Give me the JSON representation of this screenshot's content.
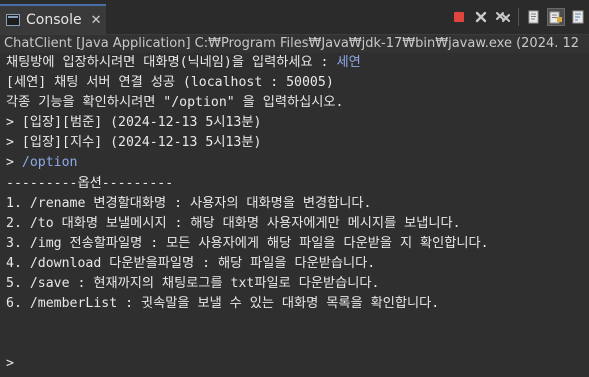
{
  "tab": {
    "label": "Console",
    "close_glyph": "✕"
  },
  "toolbar": {
    "buttons": [
      {
        "icon": "terminate-icon"
      },
      {
        "icon": "remove-launch-icon"
      },
      {
        "icon": "remove-all-terminated-icon"
      },
      {
        "icon": "clear-console-icon"
      },
      {
        "icon": "scroll-lock-icon"
      },
      {
        "icon": "word-wrap-icon"
      }
    ],
    "colors": {
      "terminate": "#e0443e",
      "gray": "#c9c9c9"
    }
  },
  "process": {
    "label": "ChatClient [Java Application] C:₩Program Files₩Java₩jdk-17₩bin₩javaw.exe  (2024. 12"
  },
  "console": {
    "colors": {
      "output": "#e8e8e8",
      "input": "#8fa8e8"
    },
    "lines": [
      {
        "text": "채팅방에 입장하시려면 대화명(닉네임)을 입력하세요 : ",
        "input": "세연"
      },
      {
        "text": "[세연] 채팅 서버 연결 성공 (localhost : 50005)"
      },
      {
        "text": "각종 기능을 확인하시려면 \"/option\" 을 입력하십시오."
      },
      {
        "text": "> [입장][범준] (2024-12-13 5시13분)"
      },
      {
        "text": "> [입장][지수] (2024-12-13 5시13분)"
      },
      {
        "text": "> ",
        "input": "/option"
      },
      {
        "text": "---------옵션---------"
      },
      {
        "text": "1. /rename 변경할대화명 : 사용자의 대화명을 변경합니다."
      },
      {
        "text": "2. /to 대화명 보낼메시지 : 해당 대화명 사용자에게만 메시지를 보냅니다."
      },
      {
        "text": "3. /img 전송할파일명 : 모든 사용자에게 해당 파일을 다운받을 지 확인합니다."
      },
      {
        "text": "4. /download 다운받을파일명 : 해당 파일을 다운받습니다."
      },
      {
        "text": "5. /save : 현재까지의 채팅로그를 txt파일로 다운받습니다."
      },
      {
        "text": "6. /memberList : 귓속말을 보낼 수 있는 대화명 목록을 확인합니다."
      },
      {
        "text": ""
      },
      {
        "text": ""
      },
      {
        "text": "> "
      }
    ]
  }
}
